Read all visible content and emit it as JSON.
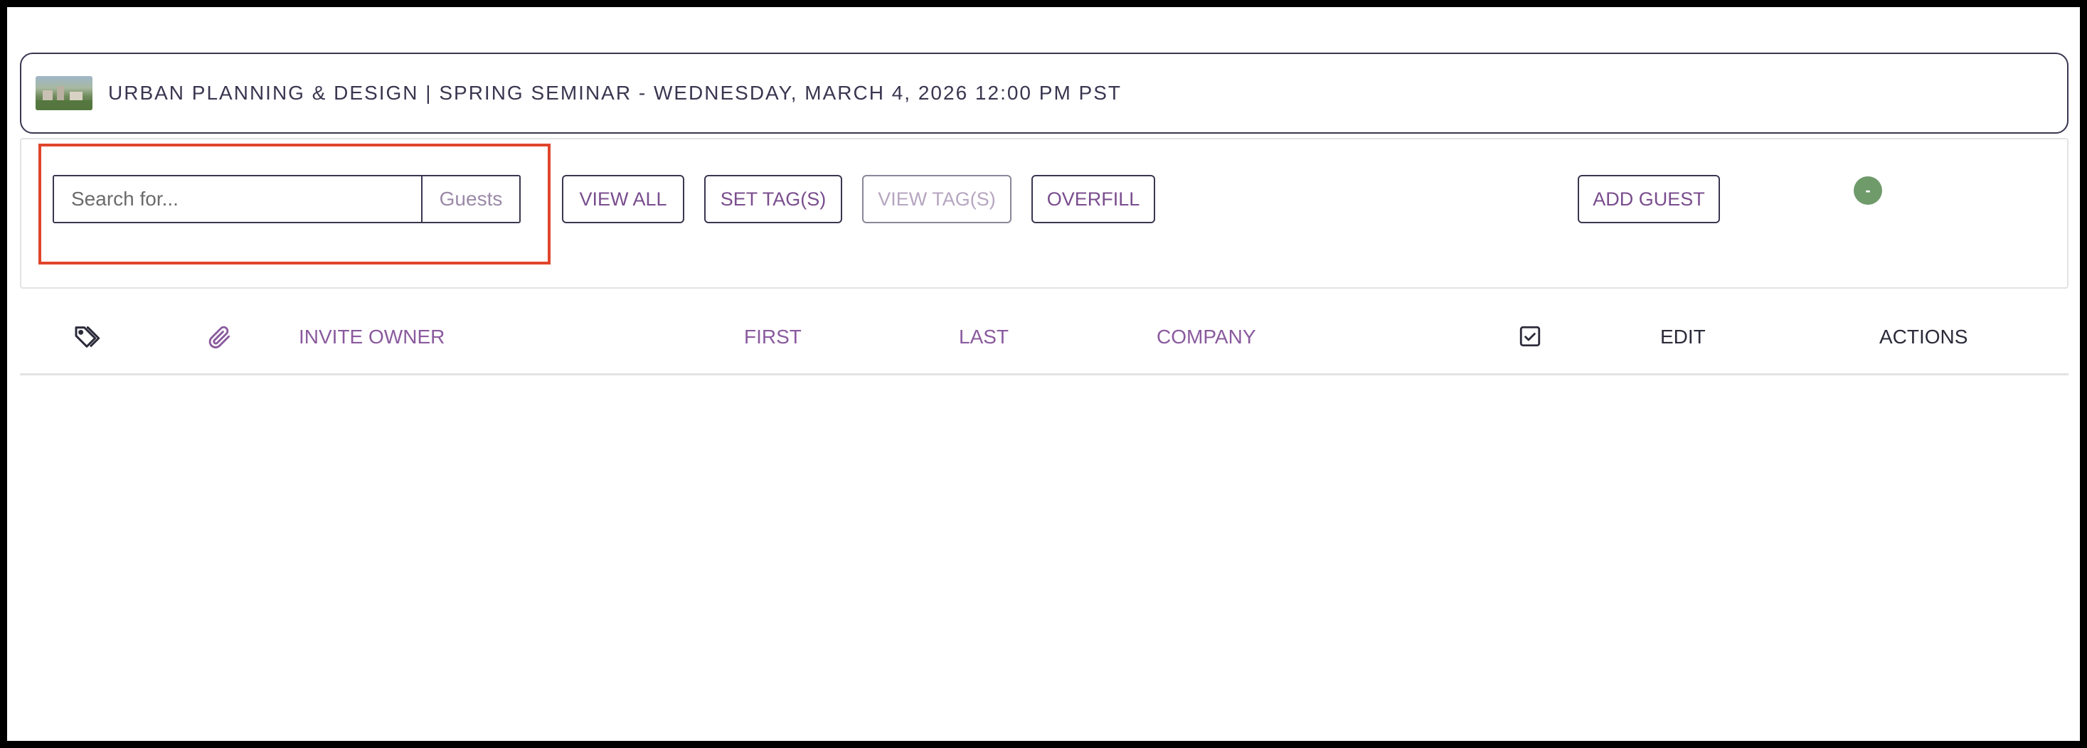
{
  "event": {
    "title": "URBAN PLANNING & DESIGN | SPRING SEMINAR - WEDNESDAY, MARCH 4, 2026 12:00 PM PST",
    "thumbnail": "event-thumbnail"
  },
  "search": {
    "placeholder": "Search for...",
    "value": "",
    "scope_label": "Guests"
  },
  "toolbar": {
    "view_all": "VIEW ALL",
    "set_tags": "SET TAG(S)",
    "view_tags": "VIEW TAG(S)",
    "overfill": "OVERFILL",
    "add_guest": "ADD GUEST",
    "status_symbol": "-"
  },
  "table": {
    "columns": {
      "tags_icon": "tag-icon",
      "attachment_icon": "paperclip-icon",
      "invite_owner": "INVITE OWNER",
      "first": "FIRST",
      "last": "LAST",
      "company": "COMPANY",
      "checked_icon": "checkbox-icon",
      "edit": "EDIT",
      "actions": "ACTIONS"
    },
    "rows": []
  },
  "colors": {
    "accent_text": "#7a4d8e",
    "border_dark": "#3a3650",
    "highlight": "#e0452b",
    "status_green": "#6f9a6a"
  }
}
